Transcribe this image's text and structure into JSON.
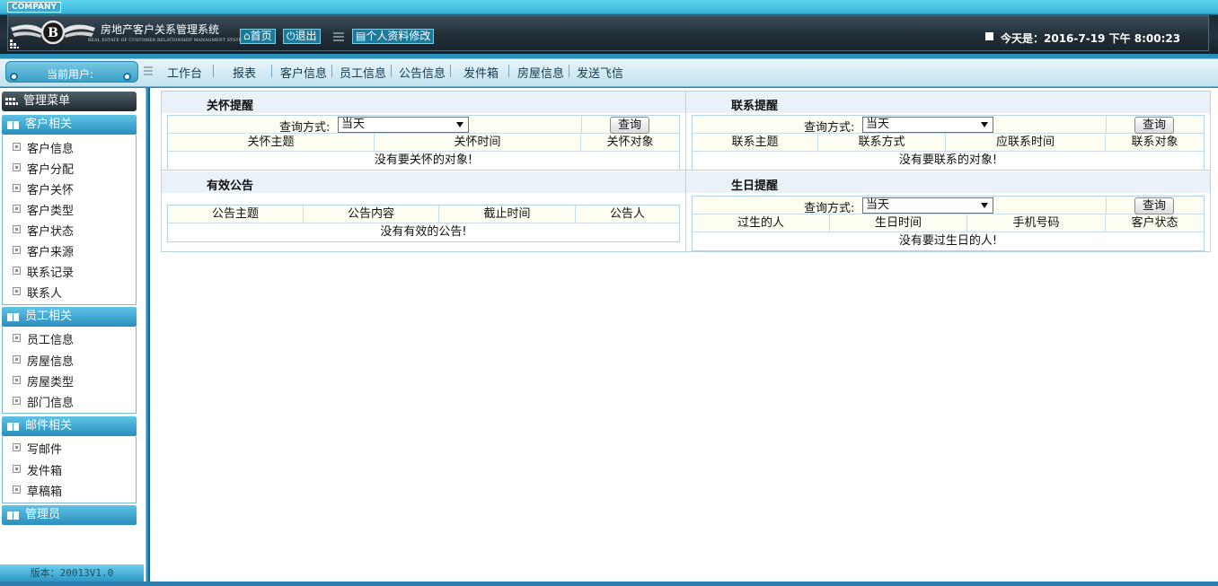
{
  "header": {
    "company_tag": "COMPANY",
    "logo_letter": "B",
    "system_title": "房地产客户关系管理系统",
    "system_subtitle": "REAL ESTATE OF CUSTOMER RELATIONSHIP MANAGMENT SYSTEM",
    "home_label": "首页",
    "logout_label": "退出",
    "profile_label": "个人资料修改",
    "date_text": "今天是：2016-7-19 下午 8:00:23"
  },
  "nav": {
    "current_user_label": "当前用户:",
    "items": [
      "工作台",
      "报表",
      "客户信息",
      "员工信息",
      "公告信息",
      "发件箱",
      "房屋信息",
      "发送飞信"
    ]
  },
  "sidebar": {
    "menu_title": "管理菜单",
    "sections": [
      {
        "title": "客户相关",
        "items": [
          "客户信息",
          "客户分配",
          "客户关怀",
          "客户类型",
          "客户状态",
          "客户来源",
          "联系记录",
          "联系人"
        ]
      },
      {
        "title": "员工相关",
        "items": [
          "员工信息",
          "房屋信息",
          "房屋类型",
          "部门信息"
        ]
      },
      {
        "title": "邮件相关",
        "items": [
          "写邮件",
          "发件箱",
          "草稿箱"
        ]
      },
      {
        "title": "管理员",
        "items": []
      }
    ],
    "version": "版本：20013V1.0"
  },
  "panels": {
    "care": {
      "title": "关怀提醒",
      "query_label": "查询方式:",
      "query_value": "当天",
      "query_button": "查询",
      "columns": [
        "关怀主题",
        "关怀时间",
        "关怀对象"
      ],
      "empty_text": "没有要关怀的对象!"
    },
    "contact": {
      "title": "联系提醒",
      "query_label": "查询方式:",
      "query_value": "当天",
      "query_button": "查询",
      "columns": [
        "联系主题",
        "联系方式",
        "应联系时间",
        "联系对象"
      ],
      "empty_text": "没有要联系的对象!"
    },
    "notice": {
      "title": "有效公告",
      "columns": [
        "公告主题",
        "公告内容",
        "截止时间",
        "公告人"
      ],
      "empty_text": "没有有效的公告!"
    },
    "birthday": {
      "title": "生日提醒",
      "query_label": "查询方式:",
      "query_value": "当天",
      "query_button": "查询",
      "columns": [
        "过生的人",
        "生日时间",
        "手机号码",
        "客户状态"
      ],
      "empty_text": "没有要过生日的人!"
    }
  },
  "colors": {
    "accent": "#2a8dbf",
    "header_dark": "#1a242c",
    "table_bg": "#fffef2",
    "border": "#b3d4e4"
  }
}
